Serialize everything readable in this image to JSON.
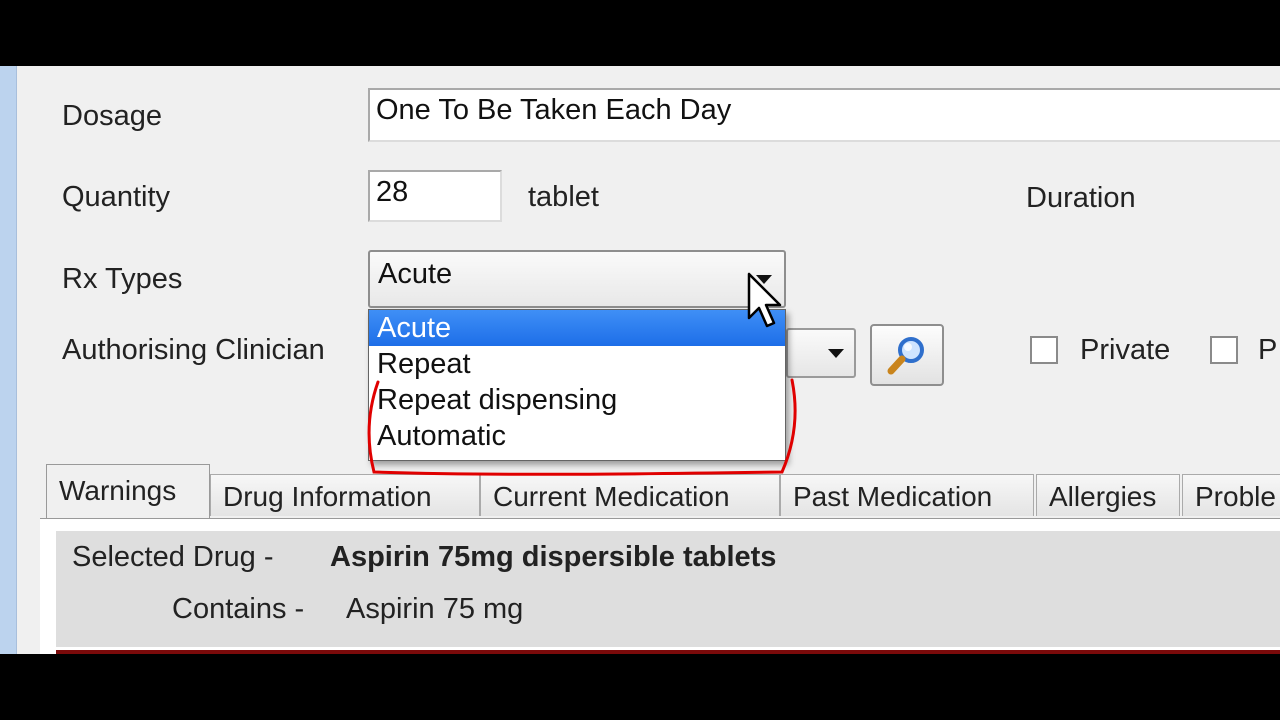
{
  "form": {
    "dosage_label": "Dosage",
    "dosage_value": "One To Be Taken Each Day",
    "quantity_label": "Quantity",
    "quantity_value": "28",
    "quantity_unit": "tablet",
    "duration_label": "Duration",
    "rx_types_label": "Rx Types",
    "rx_types_value": "Acute",
    "clinician_label": "Authorising Clinician",
    "private_label": "Private",
    "cut_checkbox_label": "P"
  },
  "dropdown": {
    "options": [
      "Acute",
      "Repeat",
      "Repeat dispensing",
      "Automatic"
    ],
    "selected_index": 0
  },
  "tabs": [
    {
      "label": "Warnings",
      "active": true
    },
    {
      "label": "Drug Information",
      "active": false
    },
    {
      "label": "Current Medication",
      "active": false
    },
    {
      "label": "Past Medication",
      "active": false
    },
    {
      "label": "Allergies",
      "active": false
    },
    {
      "label": "Proble",
      "active": false
    }
  ],
  "drug": {
    "selected_label": "Selected Drug -",
    "selected_value": "Aspirin 75mg dispersible tablets",
    "contains_label": "Contains -",
    "contains_value": "Aspirin 75 mg"
  },
  "colors": {
    "highlight": "#1d6ee8",
    "annotation": "#e00000",
    "accent_strip": "#bcd3ee"
  },
  "icons": {
    "search": "magnifier-icon",
    "dropdown": "chevron-down-icon",
    "cursor": "mouse-pointer-icon"
  }
}
